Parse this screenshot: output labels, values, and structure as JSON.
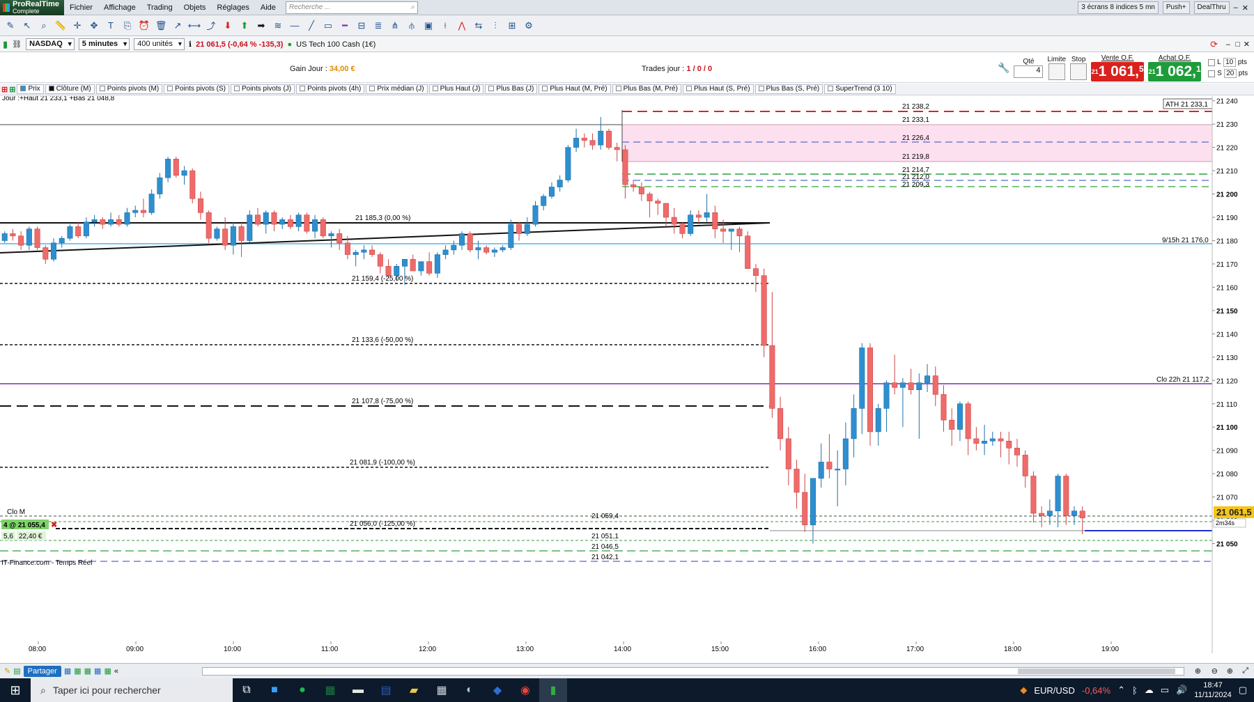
{
  "app": {
    "logo_line1": "ProRealTime",
    "logo_line2": "Complete"
  },
  "menu": [
    "Fichier",
    "Affichage",
    "Trading",
    "Objets",
    "Réglages",
    "Aide"
  ],
  "search_placeholder": "Recherche ...",
  "menubar_right": {
    "screens": "3 écrans 8 indices 5 mn",
    "push": "Push+",
    "dealthru": "DealThru"
  },
  "instrument": {
    "symbol": "NASDAQ",
    "timeframe": "5 minutes",
    "units": "400 unités",
    "quote": "21 061,5 (-0,64 % -135,3)",
    "name": "US Tech 100 Cash (1€)"
  },
  "order_panel": {
    "gain_label": "Gain Jour :",
    "gain_value": "34,00 €",
    "trades_label": "Trades jour :",
    "trades_value": "1 / 0 / 0",
    "qty_label": "Qté",
    "qty_value": "4",
    "limit_label": "Limite",
    "stop_label": "Stop",
    "sell_label": "Vente O.F.",
    "sell_price": "1 061,",
    "sell_price_small": "21",
    "sell_price_dec": "5",
    "buy_label": "Achat O.F.",
    "buy_price": "1 062,",
    "buy_price_small": "21",
    "buy_price_dec": "1",
    "l_label": "L",
    "l_value": "10",
    "s_label": "S",
    "s_value": "20",
    "pts": "pts"
  },
  "indicators": [
    "Prix",
    "Clôture (M)",
    "Points pivots (M)",
    "Points pivots (S)",
    "Points pivots (J)",
    "Points pivots (4h)",
    "Prix médian (J)",
    "Plus Haut (J)",
    "Plus Bas (J)",
    "Plus Haut (M, Pré)",
    "Plus Bas (M, Pré)",
    "Plus Haut (S, Pré)",
    "Plus Bas (S, Pré)",
    "SuperTrend (3 10)"
  ],
  "chart_data": {
    "type": "candlestick",
    "instrument": "NASDAQ",
    "timeframe": "5 minutes",
    "header_label": "Jour :+Haut 21 233,1 +Bas 21 048,8",
    "x_ticks": [
      "08:00",
      "09:00",
      "10:00",
      "11:00",
      "12:00",
      "13:00",
      "14:00",
      "15:00",
      "16:00",
      "17:00",
      "18:00",
      "19:00"
    ],
    "y_ticks": [
      "21 240",
      "21 230",
      "21 220",
      "21 210",
      "21 200",
      "21 190",
      "21 180",
      "21 170",
      "21 160",
      "21 150",
      "21 140",
      "21 130",
      "21 120",
      "21 110",
      "21 100",
      "21 090",
      "21 080",
      "21 070",
      "21 060",
      "21 050"
    ],
    "y_bold_ticks": [
      "21 200",
      "21 150",
      "21 100",
      "21 050"
    ],
    "ylim": [
      21043,
      21242
    ],
    "level_labels": {
      "l21238": "21 238,2",
      "l21233": "21 233,1",
      "l21226": "21 226,4",
      "l21219": "21 219,8",
      "l21214": "21 214,7",
      "l21212": "21 212,0",
      "l21209": "21 209,3",
      "fib0": "21 185,3 (0,00 %)",
      "fib25": "21 159,4 (-25,00 %)",
      "fib50": "21 133,6 (-50,00 %)",
      "fib75": "21 107,8 (-75,00 %)",
      "fib100": "21 081,9 (-100,00 %)",
      "fib125": "21 056,0 (-125,00 %)",
      "l21059": "21 059,4",
      "l21051": "21 051,1",
      "l21046": "21 046,5",
      "l21042": "21 042,1"
    },
    "right_labels": {
      "ath": "ATH 21 233,1",
      "h915": "9/15h 21 176,0",
      "clo22": "Clo 22h 21 117,2",
      "last": "21 061,5",
      "timer": "2m34s"
    },
    "left_labels": {
      "clo_m": "Clo M",
      "position": "4 @ 21 055,4",
      "pos_a": "5,6",
      "pos_b": "22,40 €",
      "source": "IT-Finance.com - Temps Réel"
    },
    "candles": [
      [
        21180,
        21184,
        21179,
        21183
      ],
      [
        21183,
        21185,
        21180,
        21182
      ],
      [
        21182,
        21184,
        21176,
        21178
      ],
      [
        21178,
        21186,
        21176,
        21185
      ],
      [
        21185,
        21186,
        21176,
        21177
      ],
      [
        21177,
        21178,
        21170,
        21172
      ],
      [
        21172,
        21181,
        21171,
        21179
      ],
      [
        21179,
        21182,
        21177,
        21181
      ],
      [
        21181,
        21187,
        21180,
        21186
      ],
      [
        21186,
        21188,
        21181,
        21182
      ],
      [
        21182,
        21190,
        21181,
        21188
      ],
      [
        21188,
        21191,
        21186,
        21189
      ],
      [
        21189,
        21190,
        21185,
        21187
      ],
      [
        21187,
        21192,
        21186,
        21189
      ],
      [
        21189,
        21191,
        21186,
        21187
      ],
      [
        21187,
        21194,
        21186,
        21192
      ],
      [
        21192,
        21195,
        21190,
        21193
      ],
      [
        21193,
        21198,
        21190,
        21192
      ],
      [
        21192,
        21202,
        21191,
        21200
      ],
      [
        21200,
        21209,
        21198,
        21207
      ],
      [
        21207,
        21216,
        21205,
        21215
      ],
      [
        21215,
        21216,
        21207,
        21208
      ],
      [
        21208,
        21212,
        21204,
        21210
      ],
      [
        21210,
        21211,
        21196,
        21198
      ],
      [
        21198,
        21201,
        21189,
        21192
      ],
      [
        21192,
        21193,
        21179,
        21181
      ],
      [
        21181,
        21186,
        21180,
        21185
      ],
      [
        21185,
        21190,
        21176,
        21178
      ],
      [
        21178,
        21188,
        21174,
        21186
      ],
      [
        21186,
        21187,
        21173,
        21180
      ],
      [
        21180,
        21193,
        21179,
        21191
      ],
      [
        21191,
        21194,
        21186,
        21187
      ],
      [
        21187,
        21193,
        21183,
        21192
      ],
      [
        21192,
        21193,
        21184,
        21187
      ],
      [
        21187,
        21190,
        21185,
        21189
      ],
      [
        21189,
        21191,
        21185,
        21186
      ],
      [
        21186,
        21192,
        21184,
        21191
      ],
      [
        21191,
        21192,
        21183,
        21184
      ],
      [
        21184,
        21191,
        21181,
        21189
      ],
      [
        21189,
        21190,
        21181,
        21182
      ],
      [
        21182,
        21184,
        21177,
        21183
      ],
      [
        21183,
        21185,
        21176,
        21179
      ],
      [
        21179,
        21182,
        21172,
        21174
      ],
      [
        21174,
        21176,
        21169,
        21175
      ],
      [
        21175,
        21178,
        21172,
        21176
      ],
      [
        21176,
        21178,
        21173,
        21174
      ],
      [
        21174,
        21175,
        21166,
        21169
      ],
      [
        21169,
        21172,
        21164,
        21165
      ],
      [
        21165,
        21170,
        21163,
        21169
      ],
      [
        21169,
        21172,
        21161,
        21172
      ],
      [
        21172,
        21174,
        21168,
        21167
      ],
      [
        21167,
        21171,
        21165,
        21171
      ],
      [
        21171,
        21175,
        21165,
        21166
      ],
      [
        21166,
        21175,
        21164,
        21174
      ],
      [
        21174,
        21178,
        21172,
        21176
      ],
      [
        21176,
        21180,
        21174,
        21178
      ],
      [
        21178,
        21184,
        21176,
        21183
      ],
      [
        21183,
        21184,
        21175,
        21176
      ],
      [
        21176,
        21180,
        21172,
        21177
      ],
      [
        21177,
        21178,
        21174,
        21175
      ],
      [
        21175,
        21177,
        21173,
        21176
      ],
      [
        21176,
        21178,
        21175,
        21177
      ],
      [
        21177,
        21189,
        21176,
        21187
      ],
      [
        21187,
        21188,
        21180,
        21183
      ],
      [
        21183,
        21190,
        21182,
        21187
      ],
      [
        21187,
        21197,
        21186,
        21195
      ],
      [
        21195,
        21200,
        21193,
        21199
      ],
      [
        21199,
        21205,
        21198,
        21203
      ],
      [
        21203,
        21208,
        21201,
        21206
      ],
      [
        21206,
        21221,
        21205,
        21220
      ],
      [
        21220,
        21228,
        21218,
        21224
      ],
      [
        21224,
        21226,
        21220,
        21223
      ],
      [
        21223,
        21226,
        21219,
        21221
      ],
      [
        21221,
        21233,
        21219,
        21227
      ],
      [
        21227,
        21228,
        21219,
        21220
      ],
      [
        21220,
        21222,
        21214,
        21219
      ],
      [
        21219,
        21221,
        21198,
        21204
      ],
      [
        21204,
        21206,
        21201,
        21203
      ],
      [
        21203,
        21205,
        21197,
        21200
      ],
      [
        21200,
        21201,
        21190,
        21197
      ],
      [
        21197,
        21198,
        21191,
        21196
      ],
      [
        21196,
        21196,
        21186,
        21190
      ],
      [
        21190,
        21194,
        21183,
        21187
      ],
      [
        21187,
        21188,
        21181,
        21183
      ],
      [
        21183,
        21193,
        21182,
        21191
      ],
      [
        21191,
        21193,
        21187,
        21190
      ],
      [
        21190,
        21200,
        21188,
        21192
      ],
      [
        21192,
        21195,
        21181,
        21185
      ],
      [
        21185,
        21189,
        21179,
        21184
      ],
      [
        21184,
        21185,
        21176,
        21185
      ],
      [
        21185,
        21186,
        21175,
        21182
      ],
      [
        21182,
        21184,
        21175,
        21168
      ],
      [
        21168,
        21170,
        21158,
        21165
      ],
      [
        21165,
        21168,
        21130,
        21135
      ],
      [
        21135,
        21158,
        21104,
        21108
      ],
      [
        21108,
        21113,
        21090,
        21095
      ],
      [
        21095,
        21100,
        21075,
        21082
      ],
      [
        21082,
        21086,
        21065,
        21072
      ],
      [
        21072,
        21080,
        21055,
        21058
      ],
      [
        21058,
        21078,
        21050,
        21078
      ],
      [
        21078,
        21093,
        21074,
        21085
      ],
      [
        21085,
        21097,
        21078,
        21082
      ],
      [
        21082,
        21090,
        21066,
        21082
      ],
      [
        21082,
        21102,
        21075,
        21095
      ],
      [
        21095,
        21114,
        21087,
        21108
      ],
      [
        21108,
        21136,
        21097,
        21134
      ],
      [
        21134,
        21136,
        21092,
        21098
      ],
      [
        21098,
        21110,
        21092,
        21108
      ],
      [
        21108,
        21120,
        21098,
        21119
      ],
      [
        21119,
        21131,
        21114,
        21117
      ],
      [
        21117,
        21121,
        21100,
        21119
      ],
      [
        21119,
        21125,
        21114,
        21116
      ],
      [
        21116,
        21123,
        21095,
        21119
      ],
      [
        21119,
        21127,
        21115,
        21122
      ],
      [
        21122,
        21126,
        21109,
        21114
      ],
      [
        21114,
        21118,
        21098,
        21103
      ],
      [
        21103,
        21108,
        21092,
        21099
      ],
      [
        21099,
        21111,
        21094,
        21110
      ],
      [
        21110,
        21111,
        21088,
        21095
      ],
      [
        21095,
        21100,
        21090,
        21093
      ],
      [
        21093,
        21101,
        21088,
        21094
      ],
      [
        21094,
        21098,
        21092,
        21095
      ],
      [
        21095,
        21098,
        21087,
        21094
      ],
      [
        21094,
        21098,
        21084,
        21091
      ],
      [
        21091,
        21095,
        21083,
        21088
      ],
      [
        21088,
        21090,
        21074,
        21079
      ],
      [
        21079,
        21081,
        21059,
        21063
      ],
      [
        21063,
        21066,
        21057,
        21062
      ],
      [
        21062,
        21069,
        21058,
        21064
      ],
      [
        21064,
        21080,
        21057,
        21079
      ],
      [
        21079,
        21080,
        21058,
        21062
      ],
      [
        21062,
        21066,
        21058,
        21064
      ],
      [
        21064,
        21066,
        21054,
        21061
      ]
    ]
  },
  "bottombar": {
    "share": "Partager"
  },
  "taskbar": {
    "search": "Taper ici pour rechercher",
    "fx_pair": "EUR/USD",
    "fx_change": "-0,64%",
    "time": "18:47",
    "date": "11/11/2024"
  },
  "colors": {
    "bull": "#2e8fd0",
    "bear": "#ef6b6b",
    "sell": "#d9211d",
    "buy": "#1f9c3a",
    "zone": "#fde0ef"
  }
}
